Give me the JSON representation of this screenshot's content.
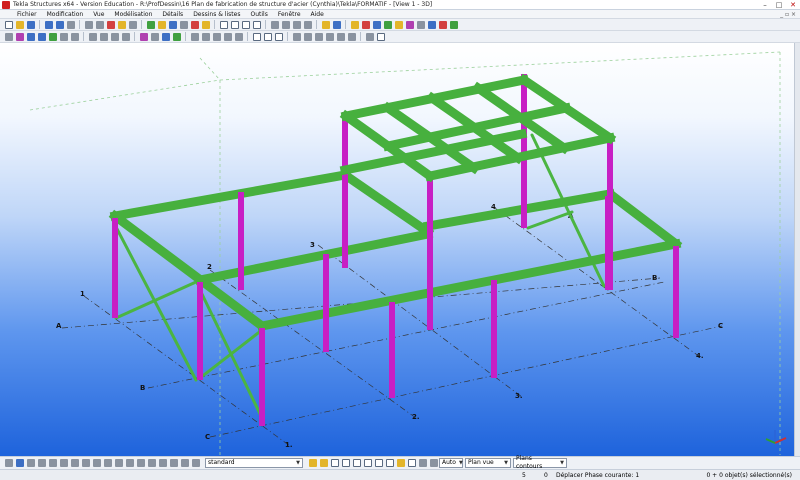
{
  "window": {
    "title": "Tekla Structures x64 - Version Education - R:\\ProfDessin\\16 Plan de fabrication de structure d'acier (Cynthia)\\Tekla\\FORMATIF - [View 1 - 3D]",
    "minimize": "–",
    "maximize": "□",
    "close": "✕"
  },
  "menu": {
    "items": [
      "Fichier",
      "Modification",
      "Vue",
      "Modélisation",
      "Détails",
      "Dessins & listes",
      "Outils",
      "Fenêtre",
      "Aide"
    ],
    "right_controls": "_ ▫ ×"
  },
  "grid_labels": {
    "numbers": [
      "1",
      "2",
      "3",
      "4",
      "1.",
      "2.",
      "3.",
      "4."
    ],
    "letters": [
      "A",
      "B",
      "C",
      "A",
      "B",
      "C"
    ]
  },
  "bottom_toolbar": {
    "filter_value": "standard",
    "mode_value": "Auto",
    "plane_value": "Plan vue",
    "contour_value": "Plans contours"
  },
  "status": {
    "count_left": "5",
    "count_right": "0",
    "message": "Déplacer  Phase courante: 1",
    "selection": "0 + 0 objet(s) sélectionné(s)"
  },
  "colors": {
    "beam_green": "#47b03e",
    "column_magenta": "#c71fc4",
    "brace_green": "#4bb542"
  }
}
